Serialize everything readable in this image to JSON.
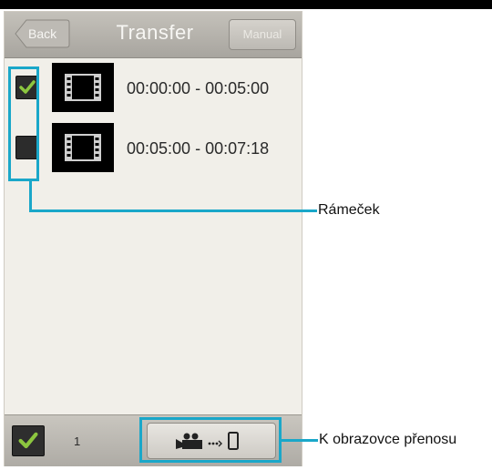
{
  "header": {
    "back_label": "Back",
    "title": "Transfer",
    "manual_label": "Manual"
  },
  "clips": [
    {
      "checked": true,
      "range": "00:00:00 - 00:05:00"
    },
    {
      "checked": false,
      "range": "00:05:00 - 00:07:18"
    }
  ],
  "footer": {
    "selected_count": "1"
  },
  "callouts": {
    "frame_label": "Rámeček",
    "transfer_screen_label": "K obrazovce přenosu"
  },
  "icons": {
    "thumbnail": "film-strip-icon",
    "check": "checkmark-icon",
    "transfer": "camcorder-to-phone-icon"
  },
  "colors": {
    "highlight": "#1aa7c9",
    "check": "#8cc63f"
  }
}
